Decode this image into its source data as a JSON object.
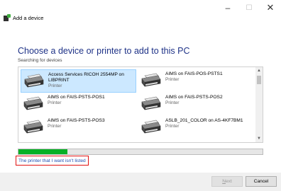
{
  "window_controls": {
    "minimize": "–",
    "maximize": "☐",
    "close": "✕"
  },
  "header": {
    "title": "Add a device"
  },
  "heading": "Choose a device or printer to add to this PC",
  "status": "Searching for devices",
  "devices": [
    {
      "name": "Access Services RICOH 2554MP on LIBPRINT",
      "type": "Printer",
      "selected": true
    },
    {
      "name": "AIMS on FAIS-POS-PSTS1",
      "type": "Printer",
      "selected": false
    },
    {
      "name": "AIMS on FAIS-PSTS-POS1",
      "type": "Printer",
      "selected": false
    },
    {
      "name": "AIMS on FAIS-PSTS-POS2",
      "type": "Printer",
      "selected": false
    },
    {
      "name": "AIMS on FAIS-PSTS-POS3",
      "type": "Printer",
      "selected": false
    },
    {
      "name": "ASLB_201_COLOR on AS-4KF7BM1",
      "type": "Printer",
      "selected": false
    }
  ],
  "progress": {
    "value": 0.2
  },
  "link": "The printer that I want isn't listed",
  "buttons": {
    "next": "Next",
    "next_mnemonic": "N",
    "next_rest": "ext",
    "cancel": "Cancel"
  },
  "colors": {
    "heading": "#1e3287",
    "progress": "#06b025",
    "link": "#1f4fb3",
    "highlight_border": "#e01010",
    "selection": "#cce8ff"
  }
}
